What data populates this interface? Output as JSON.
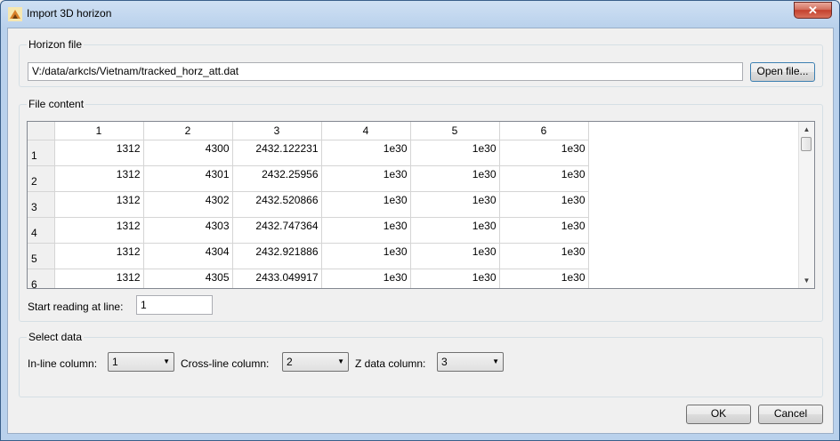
{
  "window": {
    "title": "Import 3D horizon"
  },
  "horizon_file": {
    "group_label": "Horizon file",
    "path": "V:/data/arkcls/Vietnam/tracked_horz_att.dat",
    "open_button": "Open file..."
  },
  "file_content": {
    "group_label": "File content",
    "columns": [
      "1",
      "2",
      "3",
      "4",
      "5",
      "6"
    ],
    "rows": [
      {
        "label": "1",
        "cells": [
          "1312",
          "4300",
          "2432.122231",
          "1e30",
          "1e30",
          "1e30"
        ]
      },
      {
        "label": "2",
        "cells": [
          "1312",
          "4301",
          "2432.25956",
          "1e30",
          "1e30",
          "1e30"
        ]
      },
      {
        "label": "3",
        "cells": [
          "1312",
          "4302",
          "2432.520866",
          "1e30",
          "1e30",
          "1e30"
        ]
      },
      {
        "label": "4",
        "cells": [
          "1312",
          "4303",
          "2432.747364",
          "1e30",
          "1e30",
          "1e30"
        ]
      },
      {
        "label": "5",
        "cells": [
          "1312",
          "4304",
          "2432.921886",
          "1e30",
          "1e30",
          "1e30"
        ]
      },
      {
        "label": "6",
        "cells": [
          "1312",
          "4305",
          "2433.049917",
          "1e30",
          "1e30",
          "1e30"
        ]
      }
    ],
    "start_label": "Start reading at line:",
    "start_value": "1"
  },
  "select_data": {
    "group_label": "Select data",
    "inline_label": "In-line column:",
    "inline_value": "1",
    "crossline_label": "Cross-line column:",
    "crossline_value": "2",
    "z_label": "Z data column:",
    "z_value": "3"
  },
  "buttons": {
    "ok": "OK",
    "cancel": "Cancel"
  }
}
